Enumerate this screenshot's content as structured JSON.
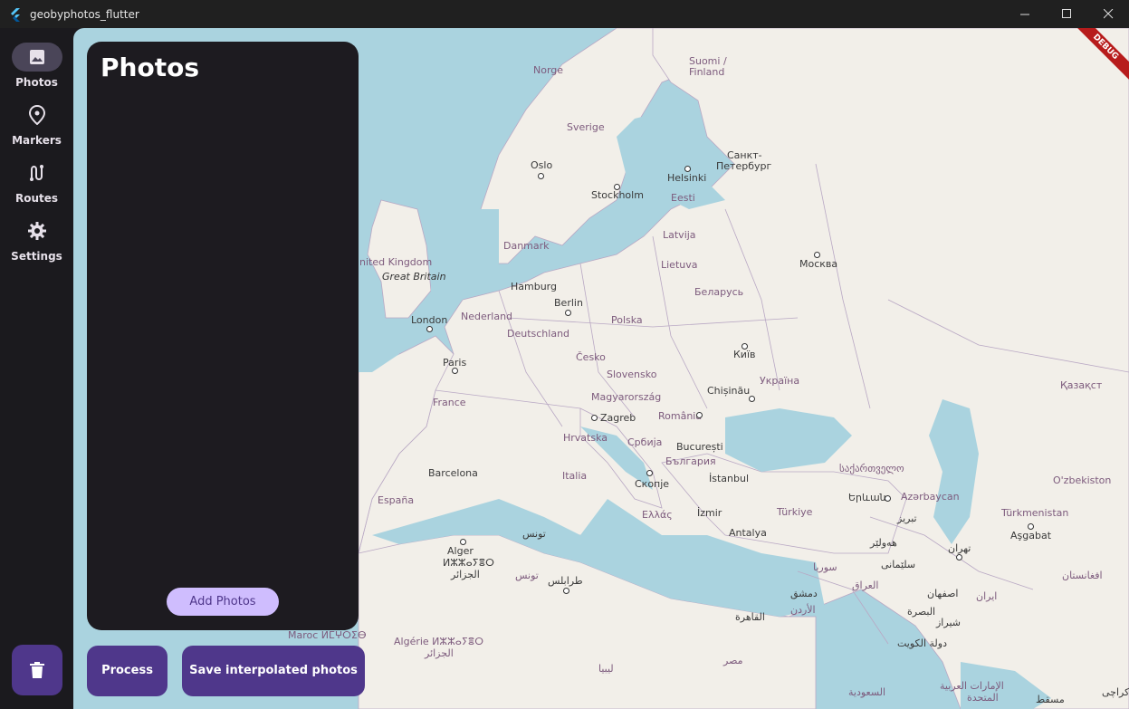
{
  "window": {
    "title": "geobyphotos_flutter"
  },
  "nav": {
    "items": [
      {
        "label": "Photos",
        "icon": "image-icon"
      },
      {
        "label": "Markers",
        "icon": "location-pin-icon"
      },
      {
        "label": "Routes",
        "icon": "route-icon"
      },
      {
        "label": "Settings",
        "icon": "gear-icon"
      }
    ],
    "active": "Photos"
  },
  "panel": {
    "title": "Photos",
    "add_button": "Add Photos"
  },
  "actions": {
    "process": "Process",
    "save": "Save interpolated photos"
  },
  "debug_banner": "DEBUG",
  "map": {
    "labels": {
      "norge": "Norge",
      "suomi": "Suomi /",
      "finland": "Finland",
      "sverige": "Sverige",
      "oslo": "Oslo",
      "stockholm": "Stockholm",
      "helsinki": "Helsinki",
      "sankt1": "Санкт-",
      "sankt2": "Петербург",
      "eesti": "Eesti",
      "danmark": "Danmark",
      "latvija": "Latvija",
      "uk": "nited Kingdom",
      "gb": "Great Britain",
      "lietuva": "Lietuva",
      "moskva": "Москва",
      "hamburg": "Hamburg",
      "berlin": "Berlin",
      "belarus": "Беларусь",
      "london": "London",
      "nederland": "Nederland",
      "polska": "Polska",
      "deutschland": "Deutschland",
      "kyiv": "Київ",
      "paris": "Paris",
      "cesko": "Česko",
      "slovensko": "Slovensko",
      "ukraina": "Україна",
      "chisinau": "Chișinău",
      "magyar": "Magyarország",
      "kazakh": "Қазақст",
      "france": "France",
      "zagreb": "Zagreb",
      "romania": "România",
      "hrvatska": "Hrvatska",
      "srbija": "Србија",
      "bucuresti": "București",
      "bulgaria": "България",
      "barcelona": "Barcelona",
      "italia": "Italia",
      "istanbul": "İstanbul",
      "georgia": "საქართველო",
      "ozbekiston": "O'zbekiston",
      "espana": "España",
      "skopje": "Скопје",
      "yerevan": "Երևան",
      "azerbaycan": "Azərbaycan",
      "ellas": "Ελλάς",
      "izmir": "İzmir",
      "turkiye": "Türkiye",
      "turkmenistan": "Türkmenistan",
      "tabriz": "تبریز",
      "antalya": "Antalya",
      "ashgabat": "Aşgabat",
      "tunis": "تونس",
      "alger": "Alger",
      "alger2": "ⵍⵣⵣⴰⵢⴻⵔ",
      "alger3": "الجزائر",
      "tunis2": "تونس",
      "tehran": "تهران",
      "tarabulus": "طرابلس",
      "suriya": "سوريا",
      "dimashq": "دمشق",
      "iraq": "العراق",
      "afghanistan": "افغانستان",
      "iran": "ایران",
      "isfahan": "اصفهان",
      "urdun": "الأردن",
      "basra": "البصرة",
      "shiraz": "شیراز",
      "qahira": "القاهرة",
      "maroc": "Maroc ⵍⵎⵖⵔⵉⴱ",
      "algerie": "Algérie ⵍⵣⵣⴰⵢⴻⵔ",
      "algerie2": "الجزائر",
      "kuwait": "دولة الكويت",
      "libya": "ليبيا",
      "misr": "مصر",
      "emirates1": "الإمارات العربية",
      "emirates2": "المتحدة",
      "saudi": "السعودية",
      "muscat": "مسقط",
      "karachi": "کراچی",
      "sulaymani": "سلێمانی",
      "hewler": "هەولێر"
    }
  }
}
